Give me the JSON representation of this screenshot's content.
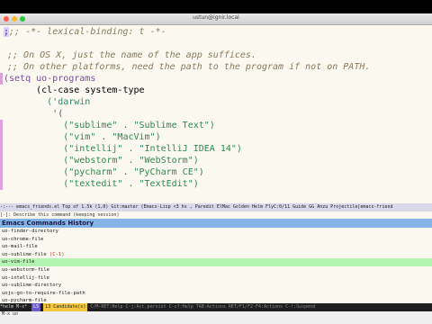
{
  "window": {
    "title": "ustun@ignir.local"
  },
  "code": {
    "lines": [
      {
        "text": ";;; -*- lexical-binding: t -*-",
        "kind": "cm",
        "cursor": true
      },
      {
        "text": "",
        "kind": "plain"
      },
      {
        "text": ";; On OS X, just the name of the app suffices.",
        "kind": "cm"
      },
      {
        "text": ";; On other platforms, need the path to the program if not on PATH.",
        "kind": "cm"
      },
      {
        "text": "(setq uo-programs",
        "kind": "setq"
      },
      {
        "text": "      (cl-case system-type",
        "kind": "case"
      },
      {
        "text": "        ('darwin",
        "kind": "sym"
      },
      {
        "text": "         '(",
        "kind": "par"
      },
      {
        "text": "           (\"sublime\" . \"Sublime Text\")",
        "kind": "str"
      },
      {
        "text": "           (\"vim\" . \"MacVim\")",
        "kind": "str"
      },
      {
        "text": "           (\"intellij\" . \"IntelliJ IDEA 14\")",
        "kind": "str"
      },
      {
        "text": "           (\"webstorm\" . \"WebStorm\")",
        "kind": "str"
      },
      {
        "text": "           (\"pycharm\" . \"PyCharm CE\")",
        "kind": "str"
      },
      {
        "text": "           (\"textedit\" . \"TextEdit\")",
        "kind": "str"
      }
    ]
  },
  "modeline": {
    "text": "-:---  emacs_friends.el   Top of 1.5k (1,0)     Git:master  (Emacs-Lisp <3 hs , Paredit ElMac Golden Helm FlyC:0/11 Guide GG Anzu Projectile[emacs-friend"
  },
  "prompt": {
    "text": "[-]: Describe this command (keeping session)"
  },
  "helm": {
    "header": "Emacs Commands History",
    "items": [
      {
        "label": "uo-finder-directory",
        "key": ""
      },
      {
        "label": "uo-chrome-file",
        "key": ""
      },
      {
        "label": "uo-mail-file",
        "key": ""
      },
      {
        "label": "uo-sublime-file",
        "key": "(C-1)"
      },
      {
        "label": "uo-vim-file",
        "key": "",
        "selected": true
      },
      {
        "label": "uo-webstorm-file",
        "key": ""
      },
      {
        "label": "uo-intellij-file",
        "key": ""
      },
      {
        "label": "uo-sublime-directory",
        "key": ""
      },
      {
        "label": "uojs-go-to-require-file-path",
        "key": ""
      },
      {
        "label": "uo-pycharm-file",
        "key": ""
      },
      {
        "label": "uo-mail-directory",
        "key": ""
      }
    ],
    "modeline": {
      "buffer": "*helm M-x*",
      "position": "L5",
      "candidates": "13 Candidate(s)",
      "help": "C/M-RET:Help C-j:Act.persist  C-c?:Help  TAB:Actions  RET/F1/F2-F4:Actions  C-!:Suspend"
    }
  },
  "minibuffer": {
    "prompt": "M-x uo"
  },
  "colors": {
    "accent": "#84b4e6",
    "selection": "#b4f5b4",
    "background": "#fbf8ef"
  }
}
